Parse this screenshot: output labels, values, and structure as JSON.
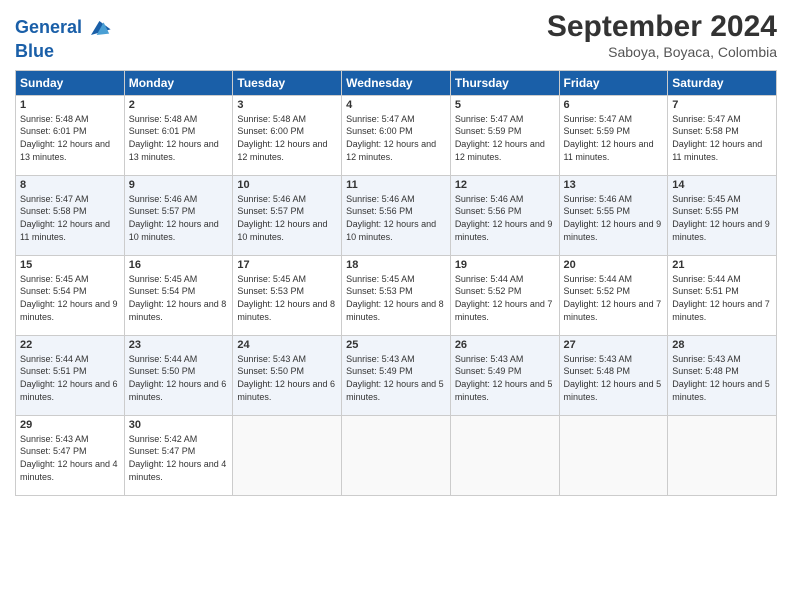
{
  "header": {
    "logo_line1": "General",
    "logo_line2": "Blue",
    "month_year": "September 2024",
    "location": "Saboya, Boyaca, Colombia"
  },
  "days_of_week": [
    "Sunday",
    "Monday",
    "Tuesday",
    "Wednesday",
    "Thursday",
    "Friday",
    "Saturday"
  ],
  "weeks": [
    [
      {
        "day": "1",
        "sunrise": "5:48 AM",
        "sunset": "6:01 PM",
        "daylight": "12 hours and 13 minutes."
      },
      {
        "day": "2",
        "sunrise": "5:48 AM",
        "sunset": "6:01 PM",
        "daylight": "12 hours and 13 minutes."
      },
      {
        "day": "3",
        "sunrise": "5:48 AM",
        "sunset": "6:00 PM",
        "daylight": "12 hours and 12 minutes."
      },
      {
        "day": "4",
        "sunrise": "5:47 AM",
        "sunset": "6:00 PM",
        "daylight": "12 hours and 12 minutes."
      },
      {
        "day": "5",
        "sunrise": "5:47 AM",
        "sunset": "5:59 PM",
        "daylight": "12 hours and 12 minutes."
      },
      {
        "day": "6",
        "sunrise": "5:47 AM",
        "sunset": "5:59 PM",
        "daylight": "12 hours and 11 minutes."
      },
      {
        "day": "7",
        "sunrise": "5:47 AM",
        "sunset": "5:58 PM",
        "daylight": "12 hours and 11 minutes."
      }
    ],
    [
      {
        "day": "8",
        "sunrise": "5:47 AM",
        "sunset": "5:58 PM",
        "daylight": "12 hours and 11 minutes."
      },
      {
        "day": "9",
        "sunrise": "5:46 AM",
        "sunset": "5:57 PM",
        "daylight": "12 hours and 10 minutes."
      },
      {
        "day": "10",
        "sunrise": "5:46 AM",
        "sunset": "5:57 PM",
        "daylight": "12 hours and 10 minutes."
      },
      {
        "day": "11",
        "sunrise": "5:46 AM",
        "sunset": "5:56 PM",
        "daylight": "12 hours and 10 minutes."
      },
      {
        "day": "12",
        "sunrise": "5:46 AM",
        "sunset": "5:56 PM",
        "daylight": "12 hours and 9 minutes."
      },
      {
        "day": "13",
        "sunrise": "5:46 AM",
        "sunset": "5:55 PM",
        "daylight": "12 hours and 9 minutes."
      },
      {
        "day": "14",
        "sunrise": "5:45 AM",
        "sunset": "5:55 PM",
        "daylight": "12 hours and 9 minutes."
      }
    ],
    [
      {
        "day": "15",
        "sunrise": "5:45 AM",
        "sunset": "5:54 PM",
        "daylight": "12 hours and 9 minutes."
      },
      {
        "day": "16",
        "sunrise": "5:45 AM",
        "sunset": "5:54 PM",
        "daylight": "12 hours and 8 minutes."
      },
      {
        "day": "17",
        "sunrise": "5:45 AM",
        "sunset": "5:53 PM",
        "daylight": "12 hours and 8 minutes."
      },
      {
        "day": "18",
        "sunrise": "5:45 AM",
        "sunset": "5:53 PM",
        "daylight": "12 hours and 8 minutes."
      },
      {
        "day": "19",
        "sunrise": "5:44 AM",
        "sunset": "5:52 PM",
        "daylight": "12 hours and 7 minutes."
      },
      {
        "day": "20",
        "sunrise": "5:44 AM",
        "sunset": "5:52 PM",
        "daylight": "12 hours and 7 minutes."
      },
      {
        "day": "21",
        "sunrise": "5:44 AM",
        "sunset": "5:51 PM",
        "daylight": "12 hours and 7 minutes."
      }
    ],
    [
      {
        "day": "22",
        "sunrise": "5:44 AM",
        "sunset": "5:51 PM",
        "daylight": "12 hours and 6 minutes."
      },
      {
        "day": "23",
        "sunrise": "5:44 AM",
        "sunset": "5:50 PM",
        "daylight": "12 hours and 6 minutes."
      },
      {
        "day": "24",
        "sunrise": "5:43 AM",
        "sunset": "5:50 PM",
        "daylight": "12 hours and 6 minutes."
      },
      {
        "day": "25",
        "sunrise": "5:43 AM",
        "sunset": "5:49 PM",
        "daylight": "12 hours and 5 minutes."
      },
      {
        "day": "26",
        "sunrise": "5:43 AM",
        "sunset": "5:49 PM",
        "daylight": "12 hours and 5 minutes."
      },
      {
        "day": "27",
        "sunrise": "5:43 AM",
        "sunset": "5:48 PM",
        "daylight": "12 hours and 5 minutes."
      },
      {
        "day": "28",
        "sunrise": "5:43 AM",
        "sunset": "5:48 PM",
        "daylight": "12 hours and 5 minutes."
      }
    ],
    [
      {
        "day": "29",
        "sunrise": "5:43 AM",
        "sunset": "5:47 PM",
        "daylight": "12 hours and 4 minutes."
      },
      {
        "day": "30",
        "sunrise": "5:42 AM",
        "sunset": "5:47 PM",
        "daylight": "12 hours and 4 minutes."
      },
      null,
      null,
      null,
      null,
      null
    ]
  ]
}
